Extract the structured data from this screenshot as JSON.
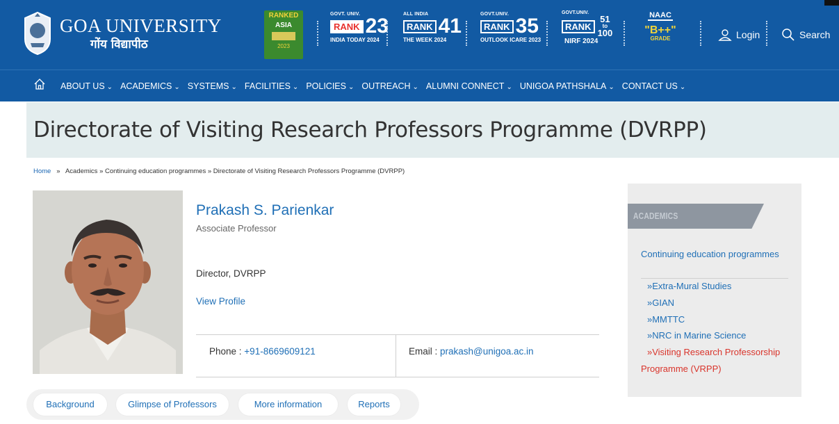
{
  "header": {
    "brand_en": "GOA UNIVERSITY",
    "brand_hi": "गोंय विद्यापीठ",
    "ranked_badge": {
      "line1": "RANKED",
      "line2": "ASIA",
      "year": "2023"
    },
    "ranks": [
      {
        "top": "GOVT. UNIV.",
        "rank": "RANK",
        "number": "23",
        "source": "INDIA TODAY 2024"
      },
      {
        "top": "ALL INDIA",
        "rank": "RANK",
        "number": "41",
        "source": "THE WEEK 2024"
      },
      {
        "top": "GOVT.UNIV.",
        "rank": "RANK",
        "number": "35",
        "source": "OUTLOOK ICARE 2023"
      }
    ],
    "nirf": {
      "top": "GOVT.UNIV.",
      "rank": "RANK",
      "range_top": "51",
      "range_mid": "to",
      "range_bottom": "100",
      "source": "NIRF 2024"
    },
    "naac": {
      "title": "NAAC",
      "grade": "\"B++\"",
      "label": "GRADE"
    },
    "login_label": "Login",
    "search_label": "Search",
    "colors": {
      "primary": "#125aa3",
      "accent_red": "#d9342b",
      "link": "#1f6fb6"
    }
  },
  "nav": {
    "items": [
      "ABOUT US",
      "ACADEMICS",
      "SYSTEMS",
      "FACILITIES",
      "POLICIES",
      "OUTREACH",
      "ALUMNI CONNECT",
      "UNIGOA PATHSHALA",
      "CONTACT US"
    ],
    "chevron": "⌄"
  },
  "page": {
    "title": "Directorate of Visiting Research Professors Programme (DVRPP)",
    "breadcrumb": {
      "home": "Home",
      "sep": "»",
      "rest": "Academics » Continuing education programmes »  Directorate of Visiting Research Professors Programme (DVRPP)"
    }
  },
  "profile": {
    "name": "Prakash S. Parienkar",
    "role": "Associate Professor",
    "position": "Director, DVRPP",
    "view_profile": "View Profile",
    "phone_label": "Phone : ",
    "phone": "+91-8669609121",
    "email_label": "Email : ",
    "email": "prakash@unigoa.ac.in"
  },
  "tabs": [
    "Background",
    "Glimpse of Professors",
    "More information",
    "Reports"
  ],
  "sidebar": {
    "banner": "ACADEMICS",
    "heading": "Continuing education programmes",
    "links": [
      {
        "label": "»Extra-Mural Studies",
        "active": false
      },
      {
        "label": "»GIAN",
        "active": false
      },
      {
        "label": "»MMTTC",
        "active": false
      },
      {
        "label": "»NRC in Marine Science",
        "active": false
      },
      {
        "label": "»Visiting Research Professorship",
        "active": true
      },
      {
        "label": "Programme (VRPP)",
        "active": true
      }
    ]
  }
}
